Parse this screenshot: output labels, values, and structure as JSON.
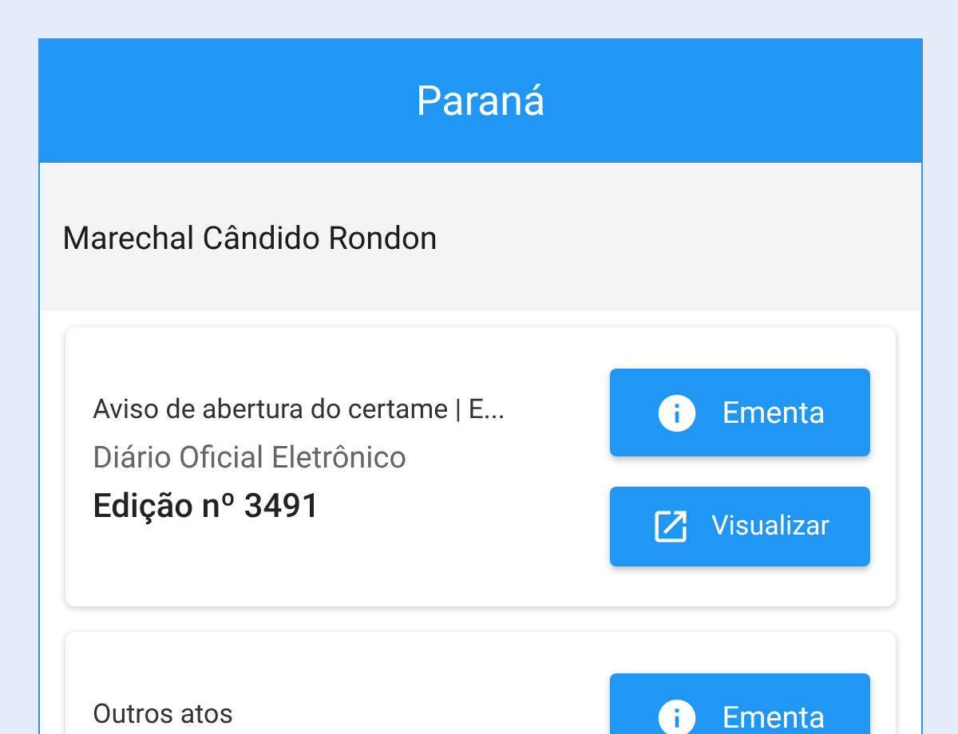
{
  "header": {
    "title": "Paraná"
  },
  "city": "Marechal Cândido Rondon",
  "cards": [
    {
      "lines": [
        {
          "kind": "subject",
          "text": "Aviso de abertura do certame | E..."
        },
        {
          "kind": "source",
          "text": "Diário Oficial Eletrônico"
        },
        {
          "kind": "edition",
          "text": "Edição nº 3491"
        }
      ],
      "buttons": [
        {
          "kind": "info",
          "label": "Ementa"
        },
        {
          "kind": "open",
          "label": "Visualizar"
        }
      ]
    },
    {
      "lines": [
        {
          "kind": "subject",
          "text": "Outros atos"
        }
      ],
      "buttons": [
        {
          "kind": "info",
          "label": "Ementa"
        }
      ]
    }
  ]
}
